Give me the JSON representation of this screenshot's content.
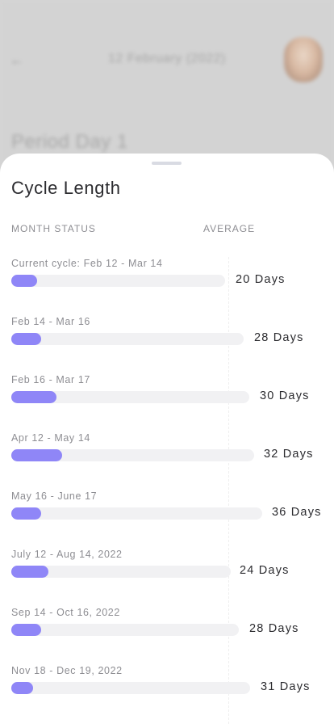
{
  "background": {
    "back_icon": "←",
    "date_label": "12 February (2022)",
    "title": "Period Day 1"
  },
  "sheet": {
    "title": "Cycle Length",
    "month_status_header": "MONTH STATUS",
    "average_header": "AVERAGE",
    "accent_color": "#8f86f7",
    "rows": [
      {
        "label": "Current cycle: Feb 12 - Mar 14",
        "days": "20 Days",
        "progress": 0.12
      },
      {
        "label": "Feb 14 - Mar 16",
        "days": "28 Days",
        "progress": 0.13
      },
      {
        "label": "Feb 16 - Mar 17",
        "days": "30 Days",
        "progress": 0.19
      },
      {
        "label": "Apr 12 - May 14",
        "days": "32 Days",
        "progress": 0.21
      },
      {
        "label": "May 16 - June 17",
        "days": "36 Days",
        "progress": 0.12
      },
      {
        "label": "July 12 - Aug 14, 2022",
        "days": "24 Days",
        "progress": 0.17
      },
      {
        "label": "Sep 14 - Oct 16, 2022",
        "days": "28 Days",
        "progress": 0.13
      },
      {
        "label": "Nov 18 - Dec 19, 2022",
        "days": "31 Days",
        "progress": 0.09
      }
    ]
  }
}
